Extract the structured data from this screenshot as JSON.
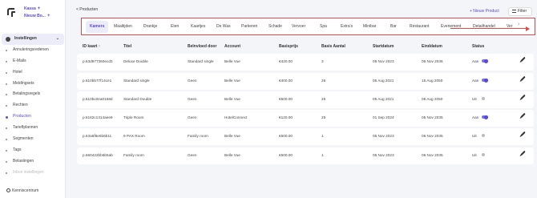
{
  "sidebar": {
    "workspace_kassa": "Kassa",
    "workspace_nieuw": "Nieuw Bo...",
    "items": [
      {
        "label": "Instellingen"
      },
      {
        "label": "Annuleringsredenen"
      },
      {
        "label": "E-Mails"
      },
      {
        "label": "Hotel"
      },
      {
        "label": "Meldingsets"
      },
      {
        "label": "Betalingsregels"
      },
      {
        "label": "Rechten"
      },
      {
        "label": "Producten"
      },
      {
        "label": "Tarieflplannen"
      },
      {
        "label": "Segmenten"
      },
      {
        "label": "Tags"
      },
      {
        "label": "Belastingen"
      },
      {
        "label": "Inbox instellingen"
      }
    ],
    "kenniscentrum": "Kenniscentrum"
  },
  "header": {
    "back_label": "< Producten",
    "new_product_label": "+ Nieuw Product",
    "filter_label": "Filter"
  },
  "tabs": [
    {
      "label": "Kamers"
    },
    {
      "label": "Maaltijden"
    },
    {
      "label": "Drankje"
    },
    {
      "label": "Eten"
    },
    {
      "label": "Kaartjes"
    },
    {
      "label": "De Was"
    },
    {
      "label": "Parkeren"
    },
    {
      "label": "Schade"
    },
    {
      "label": "Vervoer"
    },
    {
      "label": "Spa"
    },
    {
      "label": "Extra's"
    },
    {
      "label": "Minibar"
    },
    {
      "label": "Bar"
    },
    {
      "label": "Restaurant"
    },
    {
      "label": "Evenement"
    },
    {
      "label": "Detailhandel"
    },
    {
      "label": "Ver"
    }
  ],
  "table": {
    "columns": [
      "ID kaart ↑",
      "Titel",
      "Beïnvloed door",
      "Account",
      "Basisprijs",
      "Basis Aantal",
      "Startdatum",
      "Einddatum",
      "Status"
    ],
    "rows": [
      {
        "id": "p.63d977360ecd3",
        "title": "Deluxe Double",
        "influenced": "Standard single",
        "account": "Belle Vue",
        "price": "€420.00",
        "qty": "3",
        "start": "05 Nov 2023",
        "end": "06 Nov 2035",
        "status": "Aan",
        "on": true
      },
      {
        "id": "p.610bb77f14ce1",
        "title": "Standard single",
        "influenced": "Geen",
        "account": "Belle Vue",
        "price": "€400.00",
        "qty": "26",
        "start": "05 Aug 2021",
        "end": "15 Aug 2050",
        "status": "Aan",
        "on": true
      },
      {
        "id": "p.610bc0ea0168d",
        "title": "Standard Double",
        "influenced": "Geen",
        "account": "Belle Vue",
        "price": "€500.00",
        "qty": "25",
        "start": "05 Aug 2021",
        "end": "05 Aug 2050",
        "status": "Uit",
        "on": false
      },
      {
        "id": "p.6162c1314aee9",
        "title": "Triple Room",
        "influenced": "Geen",
        "account": "HotelConnect",
        "price": "€120.00",
        "qty": "25",
        "start": "01 Sep 2024",
        "end": "06 Nov 2035",
        "status": "Aan",
        "on": true
      },
      {
        "id": "p.63a6f8e6b6b11",
        "title": "9 PAX Room",
        "influenced": "Family room",
        "account": "Belle Vue",
        "price": "€500.00",
        "qty": "1",
        "start": "05 Nov 2023",
        "end": "06 Nov 2035",
        "status": "Uit",
        "on": false
      },
      {
        "id": "p.660422bb6b5ab",
        "title": "Family room",
        "influenced": "Geen",
        "account": "Belle Vue",
        "price": "€500.00",
        "qty": "1",
        "start": "05 Nov 2023",
        "end": "06 Nov 2035",
        "status": "Uit",
        "on": false
      }
    ]
  },
  "colors": {
    "accent": "#5b4bd1",
    "annotation": "#e2474b"
  }
}
